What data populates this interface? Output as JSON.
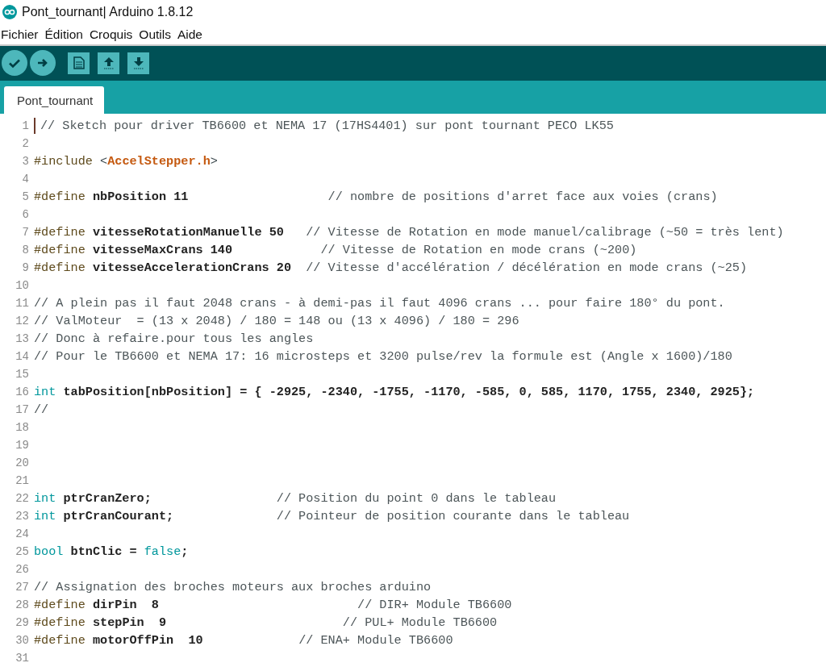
{
  "window": {
    "title": "Pont_tournant| Arduino 1.8.12"
  },
  "menu": [
    "Fichier",
    "Édition",
    "Croquis",
    "Outils",
    "Aide"
  ],
  "tabs": [
    {
      "label": "Pont_tournant",
      "selected": true
    }
  ],
  "editor": {
    "lines": [
      {
        "number": "1",
        "tokens": [
          {
            "kind": "comment",
            "text": "// Sketch pour driver TB6600 et NEMA 17 (17HS4401) sur pont tournant PECO LK55"
          }
        ]
      },
      {
        "number": "2"
      },
      {
        "number": "3",
        "tokens": [
          {
            "kind": "directive",
            "text": "#include"
          },
          {
            "kind": "plain",
            "text": " <"
          },
          {
            "kind": "library",
            "text": "AccelStepper.h"
          },
          {
            "kind": "plain",
            "text": ">"
          }
        ]
      },
      {
        "number": "4"
      },
      {
        "number": "5",
        "tokens": [
          {
            "kind": "directive",
            "text": "#define"
          },
          {
            "kind": "bold",
            "text": " nbPosition 11                   "
          },
          {
            "kind": "comment",
            "text": "// nombre de positions d'arret face aux voies (crans)"
          }
        ]
      },
      {
        "number": "6"
      },
      {
        "number": "7",
        "tokens": [
          {
            "kind": "directive",
            "text": "#define"
          },
          {
            "kind": "bold",
            "text": " vitesseRotationManuelle 50   "
          },
          {
            "kind": "comment",
            "text": "// Vitesse de Rotation en mode manuel/calibrage (~50 = très lent)"
          }
        ]
      },
      {
        "number": "8",
        "tokens": [
          {
            "kind": "directive",
            "text": "#define"
          },
          {
            "kind": "bold",
            "text": " vitesseMaxCrans 140            "
          },
          {
            "kind": "comment",
            "text": "// Vitesse de Rotation en mode crans (~200)"
          }
        ]
      },
      {
        "number": "9",
        "tokens": [
          {
            "kind": "directive",
            "text": "#define"
          },
          {
            "kind": "bold",
            "text": " vitesseAccelerationCrans 20  "
          },
          {
            "kind": "comment",
            "text": "// Vitesse d'accélération / décélération en mode crans (~25)"
          }
        ]
      },
      {
        "number": "10"
      },
      {
        "number": "11",
        "tokens": [
          {
            "kind": "comment",
            "text": "// A plein pas il faut 2048 crans - à demi-pas il faut 4096 crans ... pour faire 180° du pont."
          }
        ]
      },
      {
        "number": "12",
        "tokens": [
          {
            "kind": "comment",
            "text": "// ValMoteur  = (13 x 2048) / 180 = 148 ou (13 x 4096) / 180 = 296"
          }
        ]
      },
      {
        "number": "13",
        "tokens": [
          {
            "kind": "comment",
            "text": "// Donc à refaire.pour tous les angles"
          }
        ]
      },
      {
        "number": "14",
        "tokens": [
          {
            "kind": "comment",
            "text": "// Pour le TB6600 et NEMA 17: 16 microsteps et 3200 pulse/rev la formule est (Angle x 1600)/180"
          }
        ]
      },
      {
        "number": "15"
      },
      {
        "number": "16",
        "tokens": [
          {
            "kind": "type",
            "text": "int"
          },
          {
            "kind": "bold",
            "text": " tabPosition[nbPosition] = { -2925, -2340, -1755, -1170, -585, 0, 585, 1170, 1755, 2340, 2925};"
          }
        ]
      },
      {
        "number": "17",
        "tokens": [
          {
            "kind": "comment",
            "text": "//"
          }
        ]
      },
      {
        "number": "18"
      },
      {
        "number": "19"
      },
      {
        "number": "20"
      },
      {
        "number": "21"
      },
      {
        "number": "22",
        "tokens": [
          {
            "kind": "type",
            "text": "int"
          },
          {
            "kind": "bold",
            "text": " ptrCranZero;                 "
          },
          {
            "kind": "comment",
            "text": "// Position du point 0 dans le tableau"
          }
        ]
      },
      {
        "number": "23",
        "tokens": [
          {
            "kind": "type",
            "text": "int"
          },
          {
            "kind": "bold",
            "text": " ptrCranCourant;              "
          },
          {
            "kind": "comment",
            "text": "// Pointeur de position courante dans le tableau"
          }
        ]
      },
      {
        "number": "24"
      },
      {
        "number": "25",
        "tokens": [
          {
            "kind": "type",
            "text": "bool"
          },
          {
            "kind": "bold",
            "text": " btnClic = "
          },
          {
            "kind": "literal",
            "text": "false"
          },
          {
            "kind": "bold",
            "text": ";"
          }
        ]
      },
      {
        "number": "26"
      },
      {
        "number": "27",
        "tokens": [
          {
            "kind": "comment",
            "text": "// Assignation des broches moteurs aux broches arduino"
          }
        ]
      },
      {
        "number": "28",
        "tokens": [
          {
            "kind": "directive",
            "text": "#define"
          },
          {
            "kind": "bold",
            "text": " dirPin  8                           "
          },
          {
            "kind": "comment",
            "text": "// DIR+ Module TB6600"
          }
        ]
      },
      {
        "number": "29",
        "tokens": [
          {
            "kind": "directive",
            "text": "#define"
          },
          {
            "kind": "bold",
            "text": " stepPin  9                        "
          },
          {
            "kind": "comment",
            "text": "// PUL+ Module TB6600"
          }
        ]
      },
      {
        "number": "30",
        "tokens": [
          {
            "kind": "directive",
            "text": "#define"
          },
          {
            "kind": "bold",
            "text": " motorOffPin  10             "
          },
          {
            "kind": "comment",
            "text": "// ENA+ Module TB6600"
          }
        ]
      },
      {
        "number": "31"
      }
    ]
  }
}
